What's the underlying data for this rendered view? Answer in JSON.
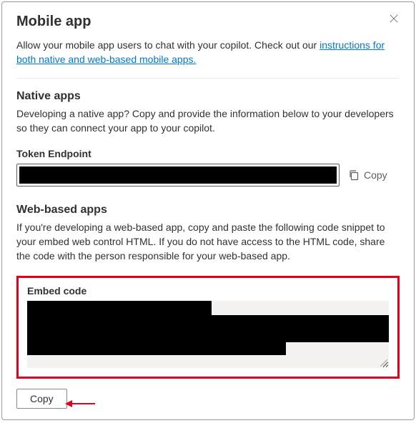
{
  "header": {
    "title": "Mobile app"
  },
  "intro": {
    "text_before_link": "Allow your mobile app users to chat with your copilot. Check out our ",
    "link_text": "instructions for both native and web-based mobile apps."
  },
  "native": {
    "title": "Native apps",
    "description": "Developing a native app? Copy and provide the information below to your developers so they can connect your app to your copilot.",
    "token_label": "Token Endpoint",
    "copy_label": "Copy"
  },
  "web": {
    "title": "Web-based apps",
    "description": "If you're developing a web-based app, copy and paste the following code snippet to your embed web control HTML. If you do not have access to the HTML code, share the code with the person responsible for your web-based app.",
    "embed_label": "Embed code",
    "copy_button": "Copy"
  }
}
